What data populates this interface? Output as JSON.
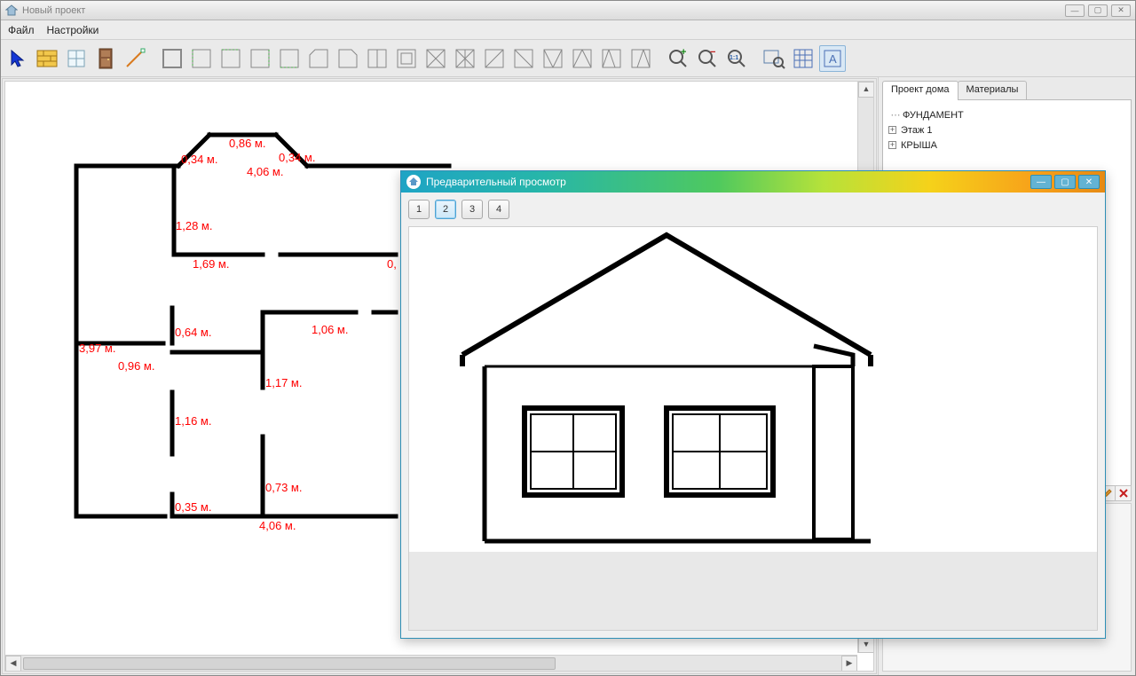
{
  "window": {
    "title": "Новый проект"
  },
  "menu": {
    "file": "Файл",
    "settings": "Настройки"
  },
  "rightpanel": {
    "tabs": {
      "project": "Проект дома",
      "materials": "Материалы"
    },
    "tree": {
      "n0": "ФУНДАМЕНТ",
      "n1": "Этаж 1",
      "n2": "КРЫША"
    }
  },
  "preview": {
    "title": "Предварительный просмотр",
    "btns": {
      "b1": "1",
      "b2": "2",
      "b3": "3",
      "b4": "4"
    }
  },
  "dims": {
    "d1": "0,86 м.",
    "d2": "0,34 м.",
    "d3": "0,34 м.",
    "d4": "4,06 м.",
    "d5": "1,28 м.",
    "d6": "1,69 м.",
    "d7": "0,",
    "d8": "0,64 м.",
    "d9": "1,06 м.",
    "d10": "3,97 м.",
    "d11": "0,96 м.",
    "d12": "1,17 м.",
    "d13": "1,16 м.",
    "d14": "0,73 м.",
    "d15": "0,35 м.",
    "d16": "4,06 м."
  }
}
